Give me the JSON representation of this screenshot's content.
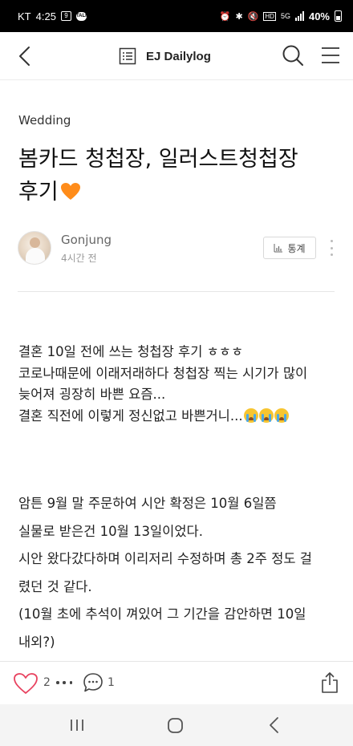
{
  "status_bar": {
    "carrier": "KT",
    "time": "4:25",
    "network": "5G",
    "battery": "40%"
  },
  "app_bar": {
    "title": "EJ Dailylog"
  },
  "post": {
    "category": "Wedding",
    "title_line1": "봄카드 청첩장, 일러스트청첩장",
    "title_line2": "후기",
    "author": "Gonjung",
    "time": "4시간 전",
    "stats_label": "통계",
    "paragraphs": [
      {
        "lines": [
          "결혼 10일 전에 쓰는 청첩장 후기 ㅎㅎㅎ",
          "코로나때문에 이래저래하다 청첩장 찍는 시기가 많이",
          "늦어져 굉장히 바쁜 요즘...",
          "결혼 직전에 이렇게 정신없고 바쁜거니..."
        ]
      },
      {
        "lines": [
          "암튼 9월 말 주문하여 시안 확정은 10월 6일쯤",
          "실물로 받은건 10월 13일이었다.",
          "시안 왔다갔다하며 이리저리 수정하며 총 2주 정도 걸",
          "렸던 것 같다.",
          "(10월 초에 추석이 껴있어 그 기간을 감안하면 10일",
          "내외?)"
        ]
      }
    ]
  },
  "actions": {
    "like_count": "2",
    "comment_count": "1"
  },
  "icons": {
    "back": "back-arrow-icon",
    "blog": "blog-list-icon",
    "search": "search-icon",
    "menu": "hamburger-menu-icon",
    "like": "heart-outline-icon",
    "comment": "speech-bubble-icon",
    "share": "share-icon",
    "title_emoji": "orange-heart-emoji",
    "crying_emoji": "loudly-crying-face-emoji"
  },
  "colors": {
    "like_heart": "#e8425f",
    "status_bar_bg": "#000000",
    "nav_bar_bg": "#f4f4f4",
    "emoji_orange": "#ff8c1a"
  }
}
